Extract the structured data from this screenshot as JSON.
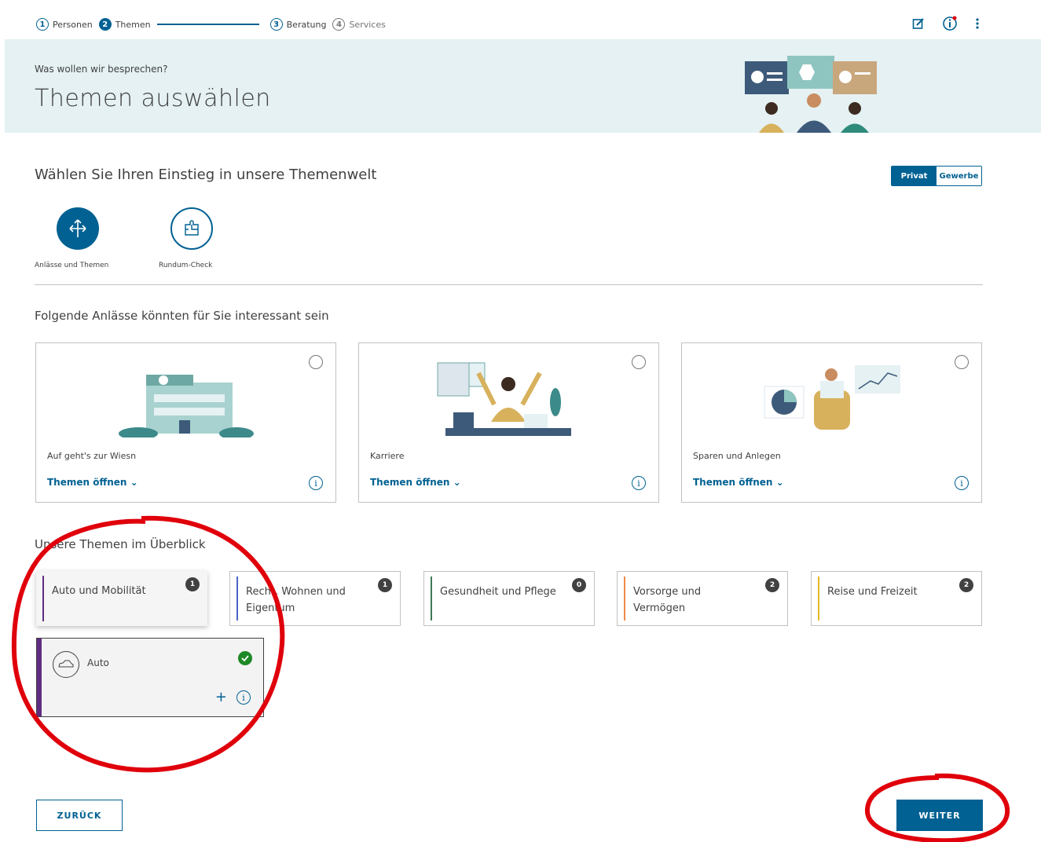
{
  "colors": {
    "primary": "#006192",
    "text": "#414141",
    "banner_bg": "#e5f1f3",
    "annotation_red": "#e0000b",
    "auto": "#5f2d82",
    "recht": "#4a64c8",
    "gesundheit": "#3d7a58",
    "vorsorge": "#f08a47",
    "reise": "#e6b81f"
  },
  "stepper": {
    "steps": [
      {
        "num": "1",
        "label": "Personen"
      },
      {
        "num": "2",
        "label": "Themen"
      },
      {
        "num": "3",
        "label": "Beratung"
      },
      {
        "num": "4",
        "label": "Services"
      }
    ]
  },
  "toolbar": {
    "icons": [
      "edit-icon",
      "info-alert-icon",
      "more-vertical-icon"
    ]
  },
  "banner": {
    "subtitle": "Was wollen wir besprechen?",
    "title": "Themen auswählen"
  },
  "entry": {
    "heading": "Wählen Sie Ihren Einstieg in unsere Themenwelt",
    "toggle": {
      "left": "Privat",
      "right": "Gewerbe"
    },
    "items": [
      {
        "label": "Anlässe und Themen",
        "icon": "directions-icon"
      },
      {
        "label": "Rundum-Check",
        "icon": "puzzle-icon"
      }
    ]
  },
  "occasions": {
    "heading": "Folgende Anlässe könnten für Sie interessant sein",
    "cards": [
      {
        "title": "Auf geht's zur Wiesn",
        "link": "Themen öffnen"
      },
      {
        "title": "Karriere",
        "link": "Themen öffnen"
      },
      {
        "title": "Sparen und Anlegen",
        "link": "Themen öffnen"
      }
    ]
  },
  "themes": {
    "heading": "Unsere Themen im Überblick",
    "tiles": [
      {
        "label": "Auto und Mobilität",
        "count": "1"
      },
      {
        "label": "Recht, Wohnen und Eigentum",
        "count": "1"
      },
      {
        "label": "Gesundheit und Pflege",
        "count": "0"
      },
      {
        "label": "Vorsorge und Vermögen",
        "count": "2"
      },
      {
        "label": "Reise und Freizeit",
        "count": "2"
      }
    ],
    "subtile": {
      "label": "Auto",
      "plus": "+"
    }
  },
  "buttons": {
    "back": "ZURÜCK",
    "next": "WEITER"
  }
}
